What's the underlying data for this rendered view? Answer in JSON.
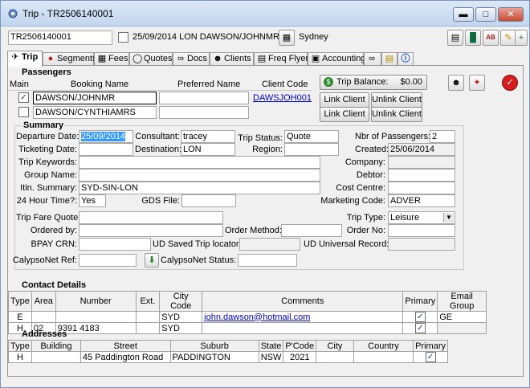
{
  "window": {
    "title": "Trip - TR2506140001",
    "trip_ref": "TR2506140001",
    "trip_desc": "25/09/2014 LON DAWSON/JOHNMR",
    "location": "Sydney"
  },
  "tabs": [
    {
      "label": "Trip"
    },
    {
      "label": "Segments"
    },
    {
      "label": "Fees"
    },
    {
      "label": "Quotes"
    },
    {
      "label": "Docs"
    },
    {
      "label": "Clients"
    },
    {
      "label": "Freq Flyer"
    },
    {
      "label": "Accounting"
    }
  ],
  "passengers": {
    "title": "Passengers",
    "headers": {
      "main": "Main",
      "booking_name": "Booking Name",
      "preferred_name": "Preferred Name",
      "client_code": "Client Code"
    },
    "rows": [
      {
        "main": true,
        "booking_name": "DAWSON/JOHNMR",
        "preferred_name": "",
        "client_code": "DAWSJOH001"
      },
      {
        "main": false,
        "booking_name": "DAWSON/CYNTHIAMRS",
        "preferred_name": "",
        "client_code": ""
      }
    ],
    "trip_balance_label": "Trip Balance:",
    "trip_balance_value": "$0.00",
    "link_client": "Link Client",
    "unlink_client": "Unlink Client"
  },
  "summary": {
    "title": "Summary",
    "departure_date_label": "Departure Date:",
    "departure_date": "25/09/2014",
    "consultant_label": "Consultant:",
    "consultant": "tracey",
    "trip_status_label": "Trip Status:",
    "trip_status": "Quote",
    "nbr_passengers_label": "Nbr of Passengers:",
    "nbr_passengers": "2",
    "ticketing_date_label": "Ticketing Date:",
    "ticketing_date": "",
    "destination_label": "Destination:",
    "destination": "LON",
    "region_label": "Region:",
    "region": "",
    "created_label": "Created:",
    "created": "25/06/2014",
    "trip_keywords_label": "Trip Keywords:",
    "trip_keywords": "",
    "company_label": "Company:",
    "company": "",
    "group_name_label": "Group Name:",
    "group_name": "",
    "debtor_label": "Debtor:",
    "debtor": "",
    "itin_summary_label": "Itin. Summary:",
    "itin_summary": "SYD-SIN-LON",
    "cost_centre_label": "Cost Centre:",
    "cost_centre": "",
    "hour24_label": "24 Hour Time?:",
    "hour24": "Yes",
    "gds_file_label": "GDS File:",
    "gds_file": "",
    "marketing_code_label": "Marketing Code:",
    "marketing_code": "ADVER",
    "trip_fare_quote_label": "Trip Fare Quote:",
    "trip_fare_quote": "",
    "trip_type_label": "Trip Type:",
    "trip_type": "Leisure",
    "ordered_by_label": "Ordered by:",
    "ordered_by": "",
    "order_method_label": "Order Method:",
    "order_method": "",
    "order_no_label": "Order No:",
    "order_no": "",
    "bpay_crn_label": "BPAY CRN:",
    "bpay_crn": "",
    "ud_saved_label": "UD Saved Trip locator:",
    "ud_saved": "",
    "ud_universal_label": "UD Universal Record:",
    "ud_universal": "",
    "calypso_ref_label": "CalypsoNet Ref:",
    "calypso_ref": "",
    "calypso_status_label": "CalypsoNet Status:",
    "calypso_status": ""
  },
  "contacts": {
    "title": "Contact Details",
    "headers": {
      "type": "Type",
      "area": "Area",
      "number": "Number",
      "ext": "Ext.",
      "city_code": "City Code",
      "comments": "Comments",
      "primary": "Primary",
      "email_group": "Email Group"
    },
    "rows": [
      {
        "type": "E",
        "area": "",
        "number": "",
        "ext": "",
        "city_code": "SYD",
        "comments": "john.dawson@hotmail.com",
        "primary": true,
        "email_group": "GE"
      },
      {
        "type": "H",
        "area": "02",
        "number": "9391 4183",
        "ext": "",
        "city_code": "SYD",
        "comments": "",
        "primary": true,
        "email_group": ""
      }
    ]
  },
  "addresses": {
    "title": "Addresses",
    "headers": {
      "type": "Type",
      "building": "Building",
      "street": "Street",
      "suburb": "Suburb",
      "state": "State",
      "pcode": "P'Code",
      "city": "City",
      "country": "Country",
      "primary": "Primary"
    },
    "rows": [
      {
        "type": "H",
        "building": "",
        "street": "45 Paddington Road",
        "suburb": "PADDINGTON",
        "state": "NSW",
        "pcode": "2021",
        "city": "",
        "country": "",
        "primary": true
      }
    ]
  },
  "colors": {
    "accent": "#3399ff",
    "link": "#0000cc",
    "close": "#c74a35"
  }
}
